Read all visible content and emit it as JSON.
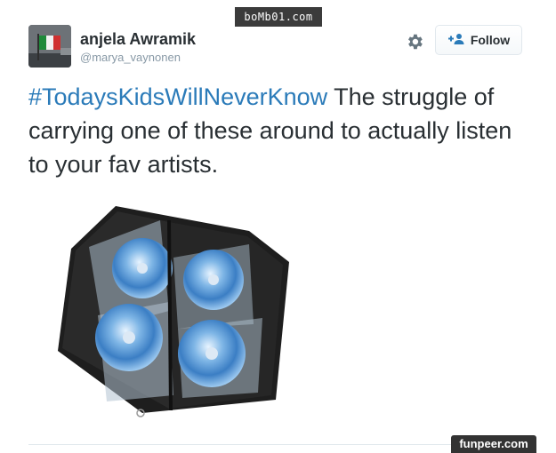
{
  "watermark_top": "boMb01.com",
  "tweet": {
    "display_name": "anjela Awramik",
    "username": "@marya_vaynonen",
    "hashtag": "#TodaysKidsWillNeverKnow",
    "text": " The struggle of carrying one of these around to actually listen to your fav artists."
  },
  "follow_button": {
    "label": "Follow",
    "icon": "add-user-icon"
  },
  "settings_icon": "gear-icon",
  "media": {
    "subject": "cd-wallet-image"
  },
  "watermark_bottom": "funpeer.com",
  "colors": {
    "hashtag": "#2b7bb9",
    "username": "#8899a6",
    "text": "#292f33",
    "follow_icon": "#2b7bb9",
    "border": "#e1e8ed"
  }
}
